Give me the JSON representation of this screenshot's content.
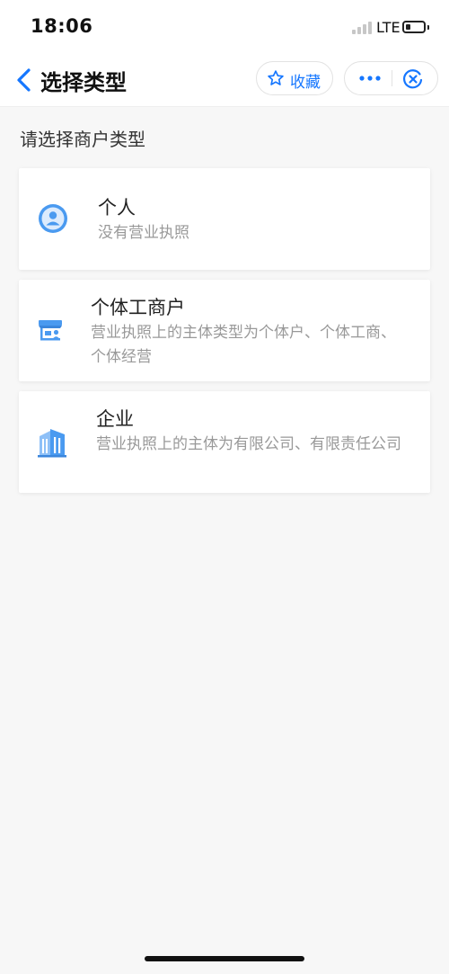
{
  "status_bar": {
    "time": "18:06",
    "network": "LTE"
  },
  "nav": {
    "title": "选择类型",
    "favorite_label": "收藏",
    "more_icon": "more-dots-icon",
    "close_icon": "close-circle-icon"
  },
  "section_title": "请选择商户类型",
  "merchant_types": [
    {
      "title": "个人",
      "description": "没有营业执照",
      "icon": "person-icon"
    },
    {
      "title": "个体工商户",
      "description": "营业执照上的主体类型为个体户、个体工商、个体经营",
      "icon": "storefront-icon"
    },
    {
      "title": "企业",
      "description": "营业执照上的主体为有限公司、有限责任公司",
      "icon": "building-icon"
    }
  ],
  "colors": {
    "accent": "#1677ff",
    "icon_blue": "#4a9af0",
    "background": "#f7f7f7",
    "card": "#ffffff",
    "secondary_text": "#999999"
  }
}
